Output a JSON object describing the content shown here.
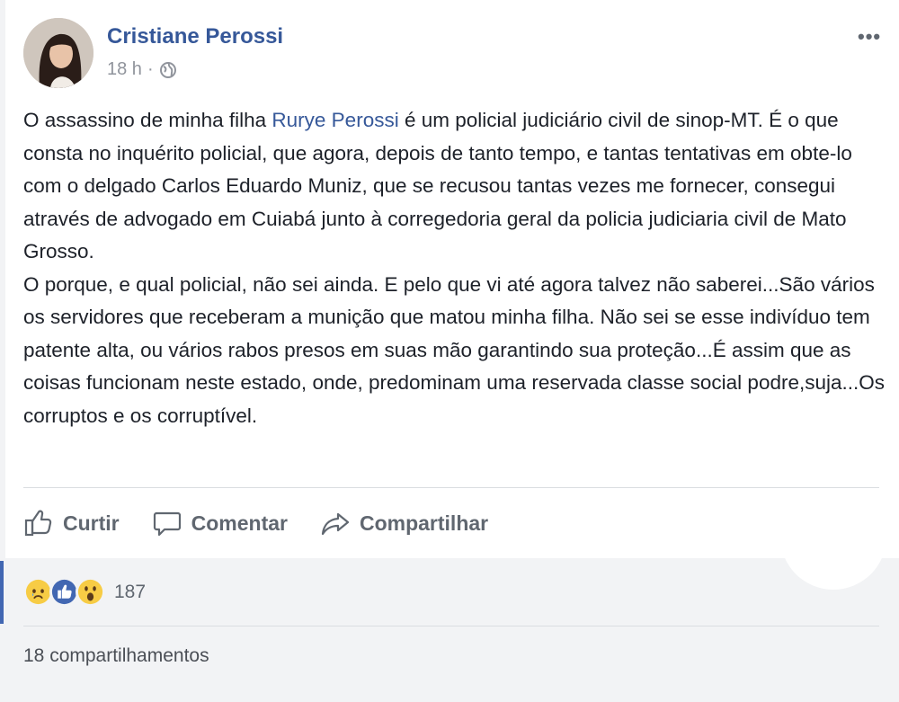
{
  "post": {
    "author": "Cristiane Perossi",
    "time": "18 h",
    "separator": "·",
    "more_label": "•••",
    "body_paragraph1_before": "O assassino de minha filha ",
    "body_mention": "Rurye Perossi",
    "body_paragraph1_after": " é um policial judiciário civil de sinop-MT. É o que consta no inquérito policial, que agora, depois de tanto tempo, e tantas tentativas em obte-lo com o delgado Carlos Eduardo Muniz, que se recusou tantas vezes me fornecer, consegui através de advogado em Cuiabá junto à corregedoria geral da policia judiciaria civil de Mato Grosso.",
    "body_paragraph2": "O porque, e qual policial, não sei ainda. E pelo que vi até agora talvez não saberei...São vários os servidores que receberam a munição que matou minha filha. Não sei se esse indivíduo tem patente alta, ou vários rabos presos em suas mão garantindo sua proteção...É assim que as coisas funcionam neste estado, onde, predominam uma reservada classe social podre,suja...Os corruptos e os corruptível."
  },
  "actions": {
    "like": "Curtir",
    "comment": "Comentar",
    "share": "Compartilhar"
  },
  "reactions": {
    "icons": [
      "sad-icon",
      "like-icon",
      "wow-icon"
    ],
    "count": "187"
  },
  "shares": "18 compartilhamentos",
  "colors": {
    "link": "#365899",
    "text": "#1d2129",
    "muted": "#606770",
    "footer_bg": "#f2f3f5",
    "like_blue": "#4267b2",
    "emoji_yellow": "#f7cc45"
  }
}
